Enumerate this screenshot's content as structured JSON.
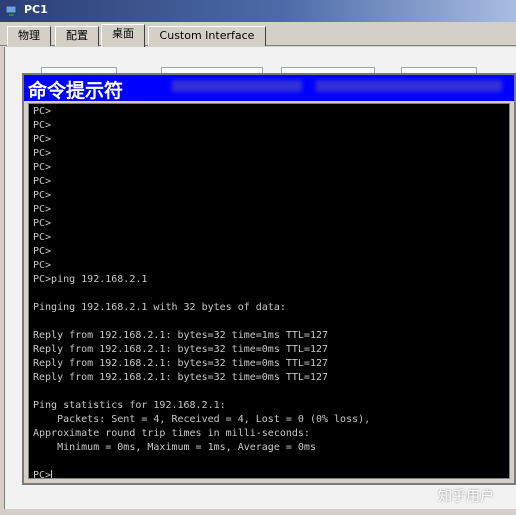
{
  "window": {
    "title": "PC1"
  },
  "tabs": [
    {
      "label": "物理"
    },
    {
      "label": "配置"
    },
    {
      "label": "桌面"
    },
    {
      "label": "Custom Interface"
    }
  ],
  "cmd": {
    "title": "命令提示符",
    "lines": [
      "PC>",
      "PC>",
      "PC>",
      "PC>",
      "PC>",
      "PC>",
      "PC>",
      "PC>",
      "PC>",
      "PC>",
      "PC>",
      "PC>",
      "PC>ping 192.168.2.1",
      "",
      "Pinging 192.168.2.1 with 32 bytes of data:",
      "",
      "Reply from 192.168.2.1: bytes=32 time=1ms TTL=127",
      "Reply from 192.168.2.1: bytes=32 time=0ms TTL=127",
      "Reply from 192.168.2.1: bytes=32 time=0ms TTL=127",
      "Reply from 192.168.2.1: bytes=32 time=0ms TTL=127",
      "",
      "Ping statistics for 192.168.2.1:",
      "    Packets: Sent = 4, Received = 4, Lost = 0 (0% loss),",
      "Approximate round trip times in milli-seconds:",
      "    Minimum = 0ms, Maximum = 1ms, Average = 0ms",
      ""
    ],
    "prompt": "PC>"
  },
  "watermark": "知乎用户",
  "colors": {
    "terminal_bg": "#000000",
    "terminal_fg": "#c8c8c8",
    "cmd_titlebar": "#0000ff"
  }
}
